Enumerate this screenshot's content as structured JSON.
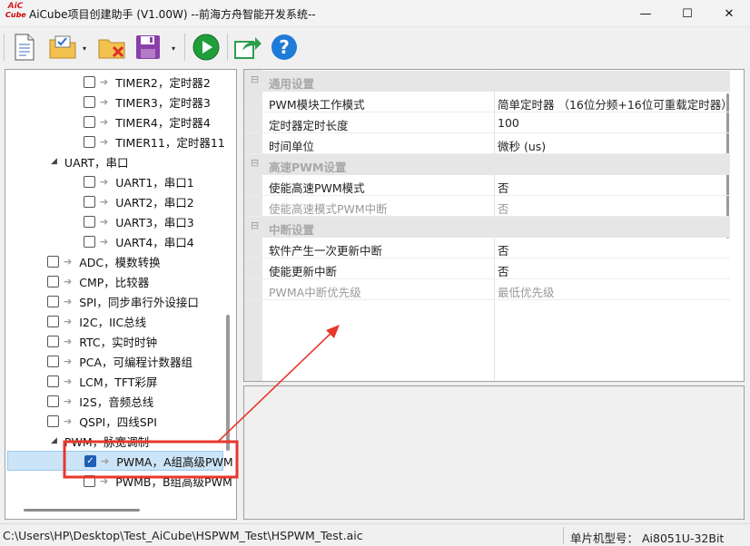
{
  "window": {
    "logo_text_top": "AiC",
    "logo_text_bottom": "Cube",
    "title": "AiCube项目创建助手 (V1.00W) --前海方舟智能开发系统--",
    "minimize": "—",
    "maximize": "☐",
    "close": "✕"
  },
  "toolbar": {
    "icons": [
      "new-file-icon",
      "open-project-icon",
      "close-project-icon",
      "save-icon",
      "run-icon",
      "export-icon",
      "help-icon"
    ],
    "help_glyph": "?",
    "dropdown_glyph": "▾",
    "colors": {
      "run": "#1f9e3a",
      "help": "#1f7bd8",
      "folder": "#f2c14e",
      "save": "#8a3fa8",
      "export": "#2f9d4f"
    }
  },
  "tree": {
    "items": [
      {
        "label": "TIMER2，定时器2",
        "checked": false
      },
      {
        "label": "TIMER3，定时器3",
        "checked": false
      },
      {
        "label": "TIMER4，定时器4",
        "checked": false
      },
      {
        "label": "TIMER11，定时器11",
        "checked": false
      },
      {
        "label": "UART，串口",
        "group": true
      },
      {
        "label": "UART1，串口1",
        "checked": false
      },
      {
        "label": "UART2，串口2",
        "checked": false
      },
      {
        "label": "UART3，串口3",
        "checked": false
      },
      {
        "label": "UART4，串口4",
        "checked": false
      },
      {
        "label": "ADC，模数转换",
        "checked": false
      },
      {
        "label": "CMP，比较器",
        "checked": false
      },
      {
        "label": "SPI，同步串行外设接口",
        "checked": false
      },
      {
        "label": "I2C，IIC总线",
        "checked": false
      },
      {
        "label": "RTC，实时时钟",
        "checked": false
      },
      {
        "label": "PCA，可编程计数器组",
        "checked": false
      },
      {
        "label": "LCM，TFT彩屏",
        "checked": false
      },
      {
        "label": "I2S，音频总线",
        "checked": false
      },
      {
        "label": "QSPI，四线SPI",
        "checked": false
      },
      {
        "label": "PWM，脉宽调制",
        "group": true
      },
      {
        "label": "PWMA，A组高级PWM",
        "checked": true,
        "selected": true
      },
      {
        "label": "PWMB，B组高级PWM",
        "checked": false
      }
    ],
    "check_glyph": "✓",
    "arrow_glyph": "➔",
    "expand_glyph": "◢"
  },
  "properties": {
    "collapse_glyph": "⊟",
    "rows": [
      {
        "type": "cat",
        "name": "通用设置"
      },
      {
        "type": "item",
        "name": "PWM模块工作模式",
        "value": "简单定时器 （16位分频+16位可重载定时器）"
      },
      {
        "type": "item",
        "name": "定时器定时长度",
        "value": "100"
      },
      {
        "type": "item",
        "name": "时间单位",
        "value": "微秒 (us)"
      },
      {
        "type": "cat",
        "name": "高速PWM设置"
      },
      {
        "type": "item",
        "name": "使能高速PWM模式",
        "value": "否"
      },
      {
        "type": "item",
        "name": "使能高速模式PWM中断",
        "value": "否",
        "disabled": true
      },
      {
        "type": "cat",
        "name": "中断设置"
      },
      {
        "type": "item",
        "name": "软件产生一次更新中断",
        "value": "否"
      },
      {
        "type": "item",
        "name": "使能更新中断",
        "value": "否"
      },
      {
        "type": "item",
        "name": "PWMA中断优先级",
        "value": "最低优先级",
        "disabled": true
      }
    ]
  },
  "status": {
    "path": "C:\\Users\\HP\\Desktop\\Test_AiCube\\HSPWM_Test\\HSPWM_Test.aic",
    "chip": "单片机型号：  Ai8051U-32Bit"
  },
  "annotation_color": "#e8372b"
}
